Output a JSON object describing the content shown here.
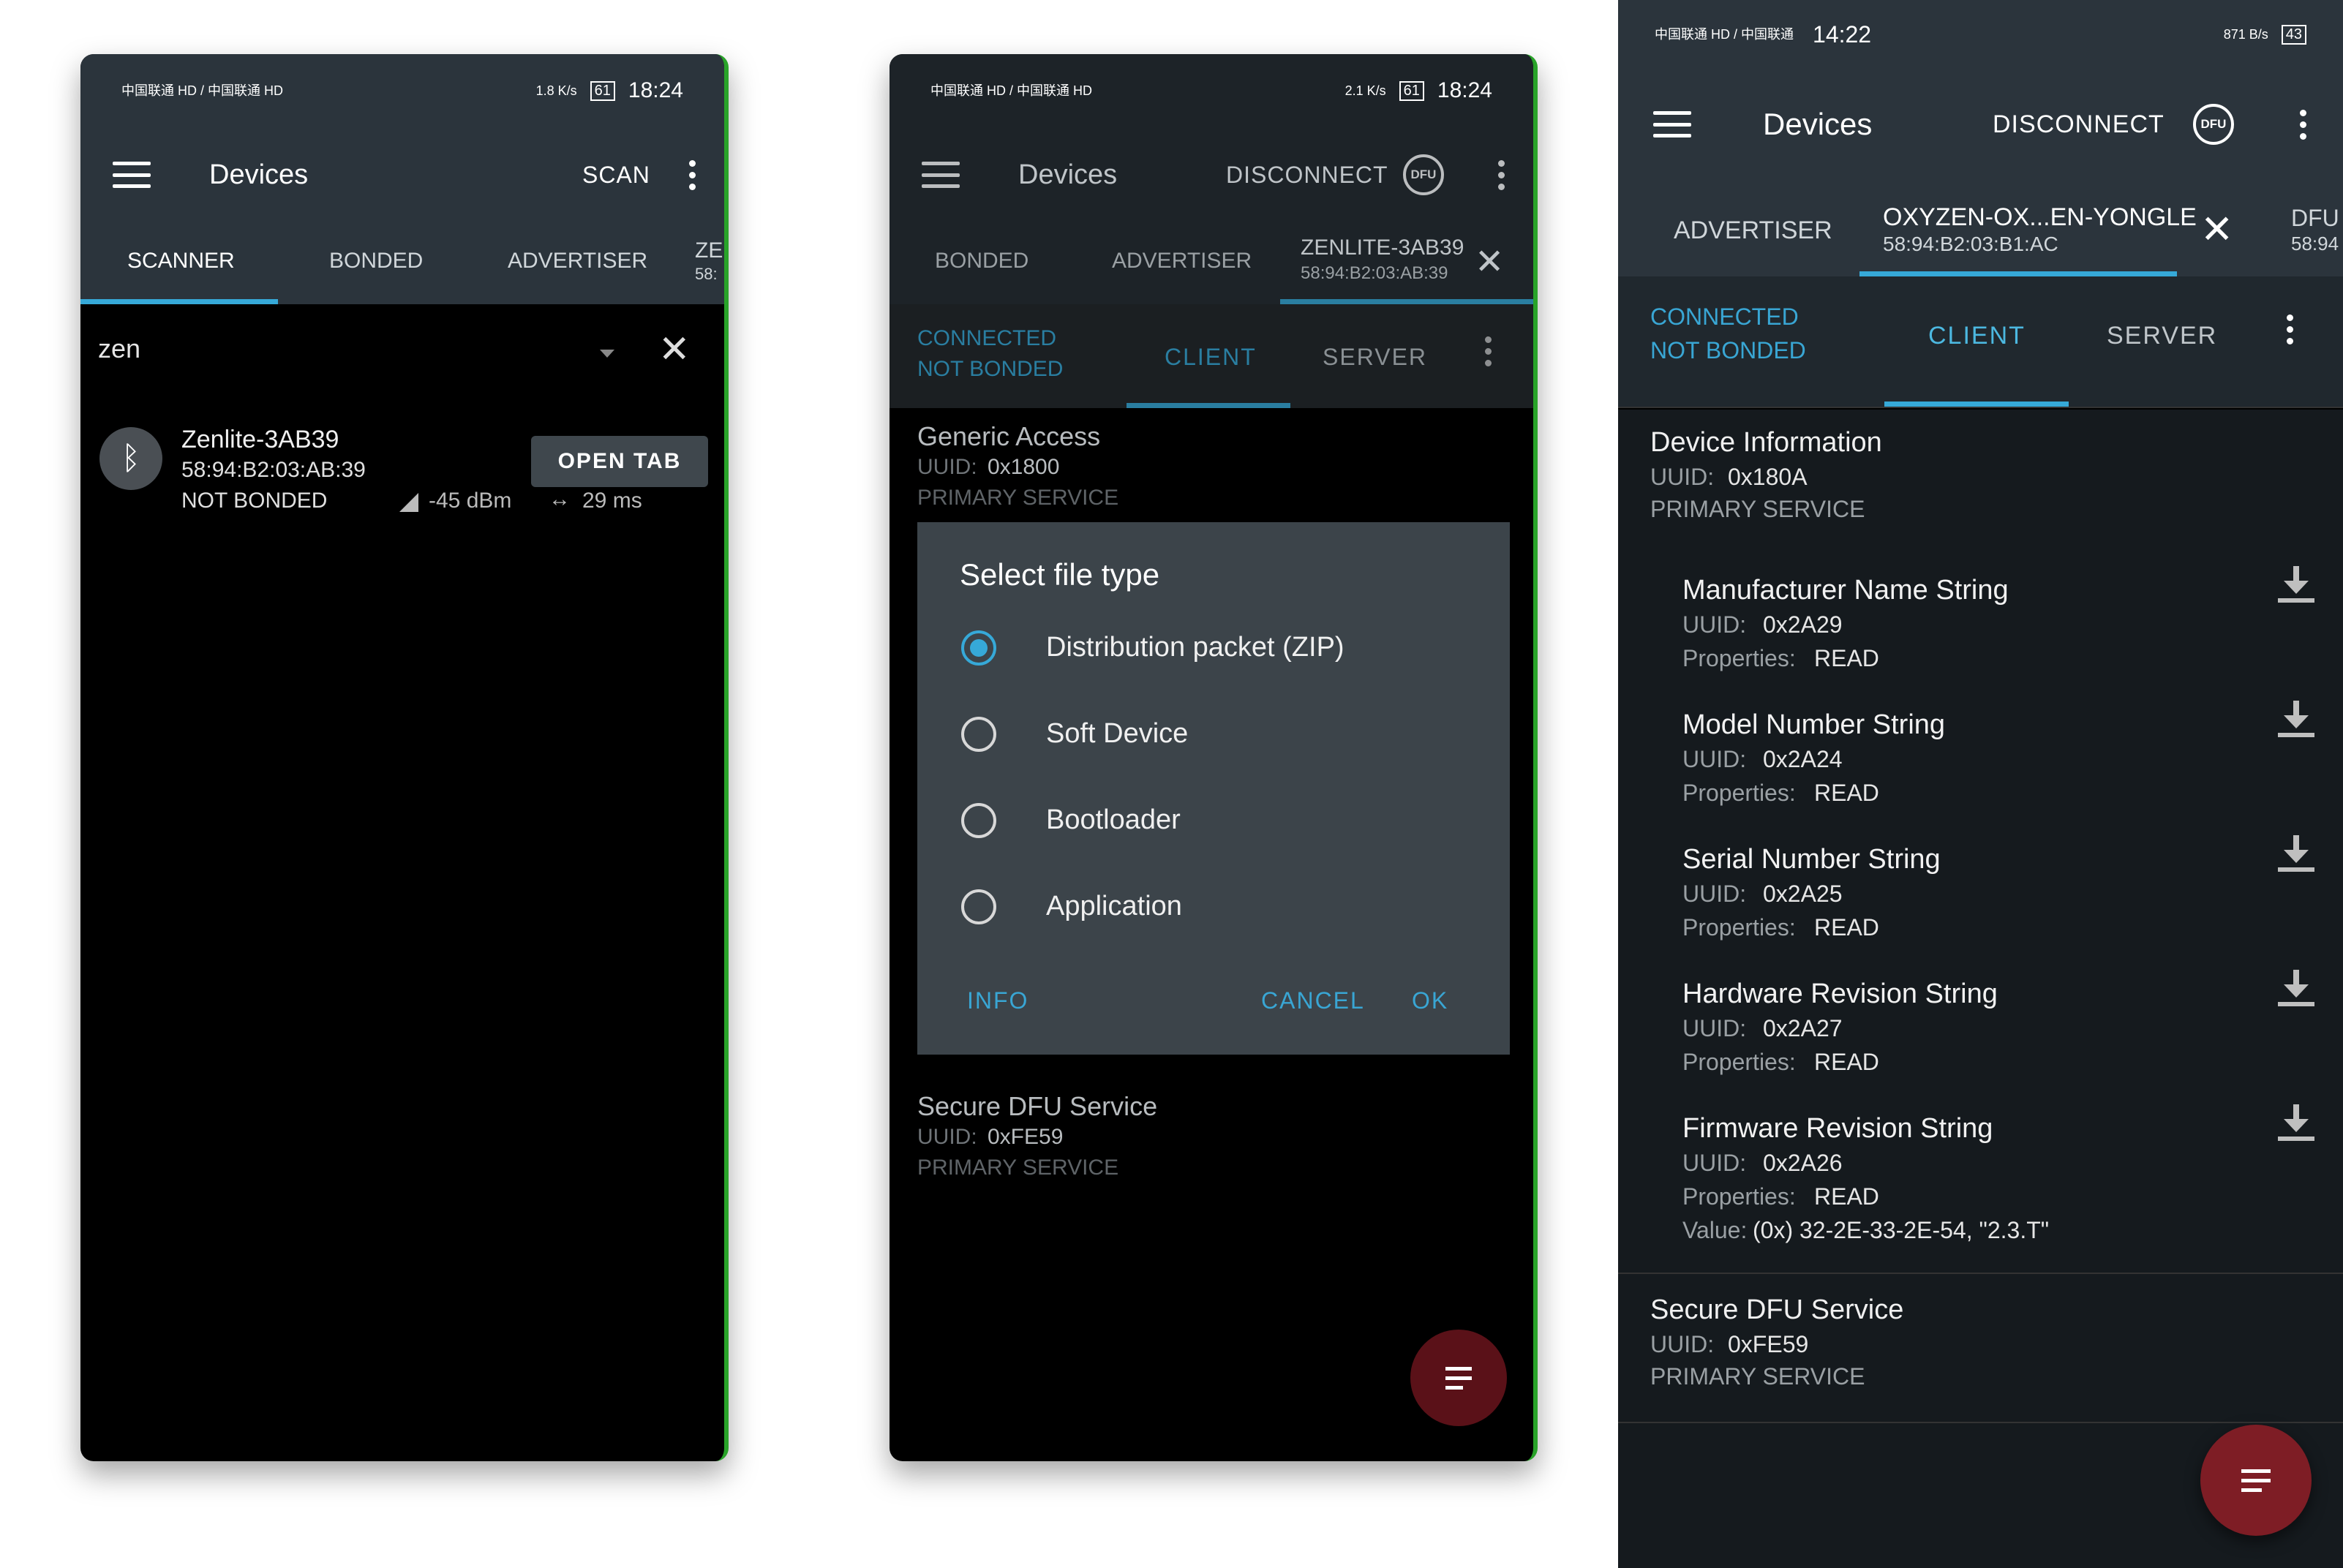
{
  "phone1": {
    "status": {
      "carrier": "中国联通 HD / 中国联通 HD",
      "net_speed": "1.8 K/s",
      "battery": "61",
      "time": "18:24"
    },
    "appbar": {
      "title": "Devices",
      "action": "SCAN"
    },
    "tabs": [
      "SCANNER",
      "BONDED",
      "ADVERTISER",
      "ZE",
      "58:"
    ],
    "filter": {
      "value": "zen"
    },
    "device": {
      "name": "Zenlite-3AB39",
      "address": "58:94:B2:03:AB:39",
      "bond": "NOT BONDED",
      "rssi": "-45 dBm",
      "interval": "29 ms",
      "open_label": "OPEN TAB"
    }
  },
  "phone2": {
    "status": {
      "carrier": "中国联通 HD / 中国联通 HD",
      "net_speed": "2.1 K/s",
      "battery": "61",
      "time": "18:24"
    },
    "appbar": {
      "title": "Devices",
      "action": "DISCONNECT",
      "dfu": "DFU"
    },
    "tabs": {
      "bonded": "BONDED",
      "advertiser": "ADVERTISER",
      "device_name": "ZENLITE-3AB39",
      "device_addr": "58:94:B2:03:AB:39"
    },
    "connection": {
      "line1": "CONNECTED",
      "line2": "NOT BONDED"
    },
    "subtabs": {
      "client": "CLIENT",
      "server": "SERVER"
    },
    "service1": {
      "title": "Generic Access",
      "uuid_label": "UUID:",
      "uuid": "0x1800",
      "type": "PRIMARY SERVICE"
    },
    "dialog": {
      "title": "Select file type",
      "options": [
        "Distribution packet (ZIP)",
        "Soft Device",
        "Bootloader",
        "Application"
      ],
      "selected": 0,
      "info": "INFO",
      "cancel": "CANCEL",
      "ok": "OK"
    },
    "service_last": {
      "title": "Secure DFU Service",
      "uuid_label": "UUID:",
      "uuid": "0xFE59",
      "type": "PRIMARY SERVICE"
    }
  },
  "phone3": {
    "status": {
      "carrier": "中国联通 HD / 中国联通",
      "time": "14:22",
      "net_speed": "871 B/s",
      "battery": "43"
    },
    "appbar": {
      "title": "Devices",
      "action": "DISCONNECT",
      "dfu": "DFU"
    },
    "tabs": {
      "advertiser": "ADVERTISER",
      "device_name": "OXYZEN-OX...EN-YONGLE",
      "device_addr": "58:94:B2:03:B1:AC",
      "next": "DFU",
      "next_addr": "58:94"
    },
    "connection": {
      "line1": "CONNECTED",
      "line2": "NOT BONDED"
    },
    "subtabs": {
      "client": "CLIENT",
      "server": "SERVER"
    },
    "service": {
      "title": "Device Information",
      "uuid_label": "UUID:",
      "uuid": "0x180A",
      "type": "PRIMARY SERVICE"
    },
    "characteristics": [
      {
        "name": "Manufacturer Name String",
        "uuid": "0x2A29",
        "props": "READ"
      },
      {
        "name": "Model Number String",
        "uuid": "0x2A24",
        "props": "READ"
      },
      {
        "name": "Serial Number String",
        "uuid": "0x2A25",
        "props": "READ"
      },
      {
        "name": "Hardware Revision String",
        "uuid": "0x2A27",
        "props": "READ"
      },
      {
        "name": "Firmware Revision String",
        "uuid": "0x2A26",
        "props": "READ",
        "value": "(0x) 32-2E-33-2E-54, \"2.3.T\""
      }
    ],
    "labels": {
      "uuid": "UUID:",
      "props": "Properties:",
      "value": "Value:"
    },
    "service2": {
      "title": "Secure DFU Service",
      "uuid_label": "UUID:",
      "uuid": "0xFE59",
      "type": "PRIMARY SERVICE"
    }
  },
  "colors": {
    "bar": "#2b343c",
    "accent": "#36a9d8",
    "fab": "#7e1d25",
    "screen": "#000000"
  }
}
